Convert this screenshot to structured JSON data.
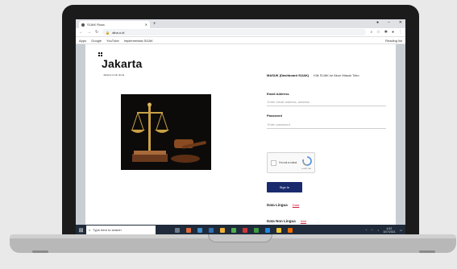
{
  "browser": {
    "tab_title": "SIJAK Rusa",
    "new_tab": "+",
    "window_controls": [
      "●",
      "–",
      "✕"
    ],
    "url": "dina.o.id",
    "bookmarks": [
      "Apps",
      "Google",
      "YouTube",
      "Implementasi SIJAK"
    ],
    "reading_list": "Reading list"
  },
  "page": {
    "logo": "Jakarta",
    "tagline": "Jakarta untuk dunia",
    "form": {
      "header_bold": "MASUK (Dashboard SIJAK)",
      "header_note": "Klik SIJAK ke Akun Masuk Toko",
      "email_label": "Email Address",
      "email_placeholder": "Enter email address, address",
      "password_label": "Password",
      "password_placeholder": "Enter password",
      "captcha_text": "I'm not a robot",
      "captcha_brand": "reCAPTCHA",
      "sign_in": "Sign In",
      "row1_label": "Data Lingua",
      "row1_link": "Data",
      "row2_label": "Data Non Lingua",
      "row2_link": "Ikhti"
    }
  },
  "taskbar": {
    "search_placeholder": "Type here to search",
    "clock_time": "4:52",
    "clock_date": "10/7/2021",
    "app_colors": [
      "#6c7a89",
      "#e0683c",
      "#3e8ed0",
      "#2f6fb6",
      "#f2b134",
      "#4caf50",
      "#d13438",
      "#3c9d41",
      "#1e88e5",
      "#f4c430",
      "#ef6c00"
    ]
  }
}
